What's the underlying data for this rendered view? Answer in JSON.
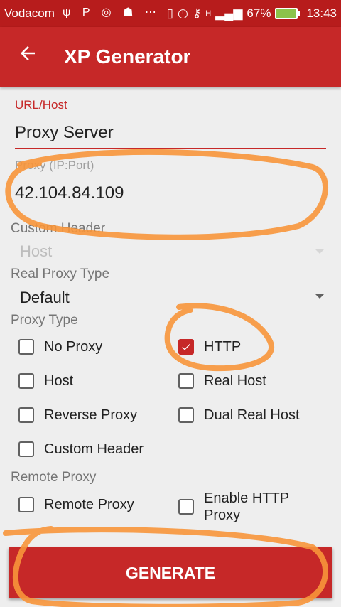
{
  "status_bar": {
    "carrier": "Vodacom",
    "signal": "H",
    "battery": "67%",
    "time": "13:43"
  },
  "app_bar": {
    "title": "XP Generator",
    "back_icon": "arrow-back-icon"
  },
  "form": {
    "url_host": {
      "label": "URL/Host",
      "value": "Proxy Server"
    },
    "proxy": {
      "label": "Proxy (IP:Port)",
      "value": "42.104.84.109"
    },
    "custom_header": {
      "label": "Custom Header",
      "value": "Host"
    },
    "real_proxy_type": {
      "label": "Real Proxy Type",
      "value": "Default"
    }
  },
  "proxy_type": {
    "label": "Proxy Type",
    "options": [
      {
        "label": "No Proxy",
        "checked": false
      },
      {
        "label": "HTTP",
        "checked": true
      },
      {
        "label": "Host",
        "checked": false
      },
      {
        "label": "Real Host",
        "checked": false
      },
      {
        "label": "Reverse Proxy",
        "checked": false
      },
      {
        "label": "Dual Real Host",
        "checked": false
      },
      {
        "label": "Custom Header",
        "checked": false
      }
    ]
  },
  "remote_proxy": {
    "label": "Remote Proxy",
    "options": [
      {
        "label": "Remote Proxy",
        "checked": false
      },
      {
        "label": "Enable HTTP Proxy",
        "checked": false
      }
    ]
  },
  "generate_button": {
    "label": "GENERATE"
  },
  "colors": {
    "primary": "#c62828",
    "primary_dark": "#b71c1c",
    "annotation": "#f7953a"
  }
}
